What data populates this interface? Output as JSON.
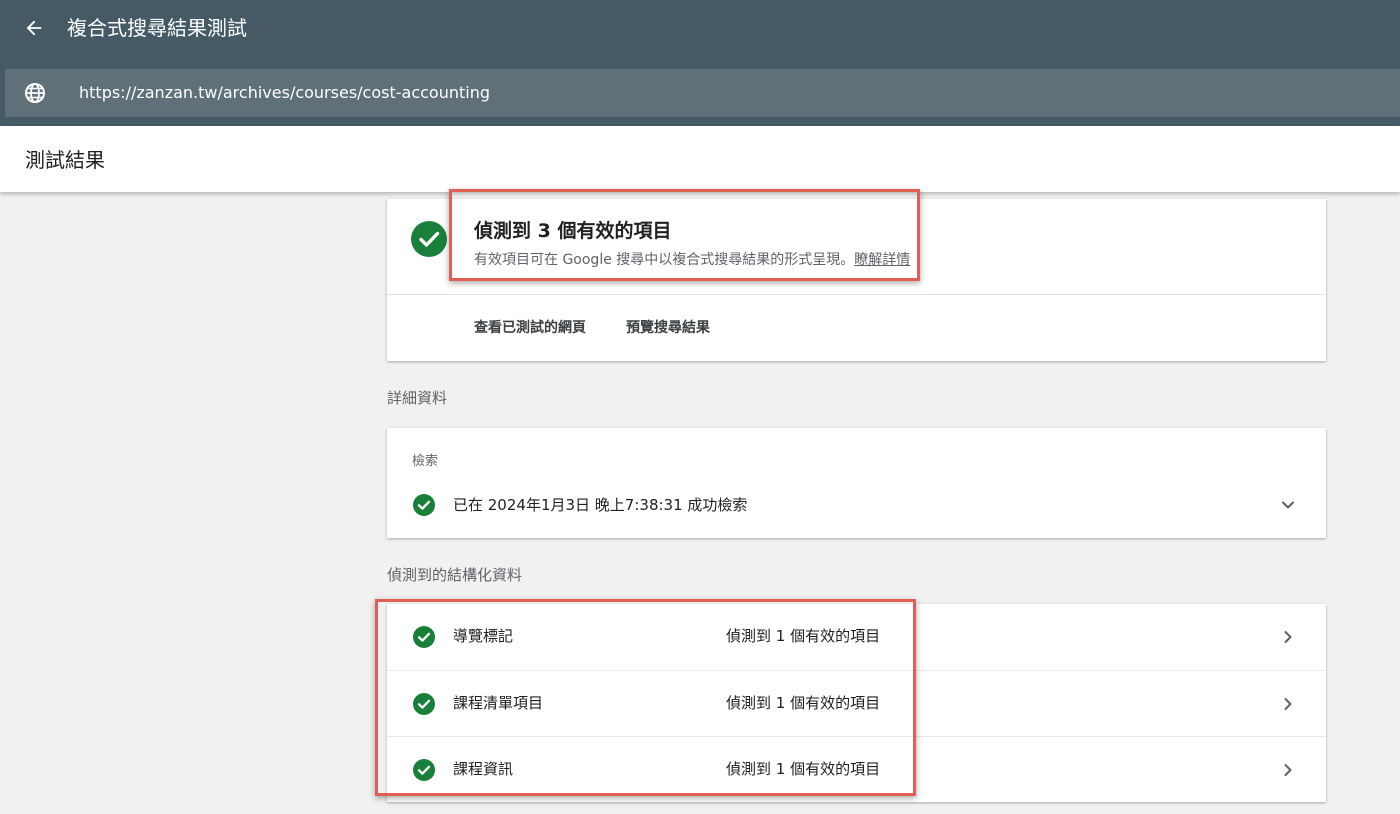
{
  "appbar": {
    "title": "複合式搜尋結果測試",
    "back_icon": "arrow-back-icon",
    "url": "https://zanzan.tw/archives/courses/cost-accounting",
    "url_icon": "globe-icon"
  },
  "subheader": {
    "title": "測試結果"
  },
  "summary": {
    "title": "偵測到 3 個有效的項目",
    "subtitle": "有效項目可在 Google 搜尋中以複合式搜尋結果的形式呈現。",
    "learn_more": "瞭解詳情",
    "actions": [
      {
        "label": "查看已測試的網頁"
      },
      {
        "label": "預覽搜尋結果"
      }
    ]
  },
  "details": {
    "section_label": "詳細資料",
    "crawl_heading": "檢索",
    "crawl_status": "已在 2024年1月3日 晚上7:38:31 成功檢索"
  },
  "structured": {
    "section_label": "偵測到的結構化資料",
    "items": [
      {
        "name": "導覽標記",
        "status": "偵測到 1 個有效的項目"
      },
      {
        "name": "課程清單項目",
        "status": "偵測到 1 個有效的項目"
      },
      {
        "name": "課程資訊",
        "status": "偵測到 1 個有效的項目"
      }
    ]
  },
  "colors": {
    "appbar": "#455a64",
    "urlbar": "#607078",
    "success": "#188038",
    "highlight": "#e06055"
  }
}
